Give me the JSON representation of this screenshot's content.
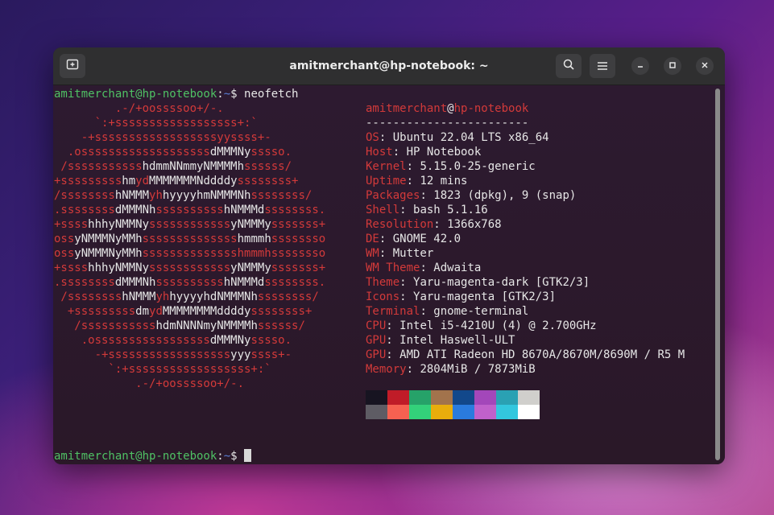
{
  "window": {
    "title": "amitmerchant@hp-notebook: ~"
  },
  "toolbar": {
    "new_tab_icon": "new-tab-icon",
    "search_icon": "search-icon",
    "menu_icon": "hamburger-menu-icon",
    "minimize_icon": "minimize-icon",
    "maximize_icon": "maximize-icon",
    "close_icon": "close-icon"
  },
  "prompt": {
    "user_host": "amitmerchant@hp-notebook",
    "sep": ":",
    "path": "~",
    "dollar": "$ ",
    "command": "neofetch"
  },
  "logo": [
    [
      [
        "r",
        "         .-/+oossssoo+/-."
      ]
    ],
    [
      [
        "r",
        "      `:+ssssssssssssssssss+:`"
      ]
    ],
    [
      [
        "r",
        "    -+ssssssssssssssssssyyssss+-"
      ]
    ],
    [
      [
        "r",
        "  .osssssssssssssssssss"
      ],
      [
        "w",
        "dMMMNy"
      ],
      [
        "r",
        "sssso."
      ]
    ],
    [
      [
        "r",
        " /sssssssssss"
      ],
      [
        "w",
        "hdmmNNmmyNMMMMh"
      ],
      [
        "r",
        "ssssss/"
      ]
    ],
    [
      [
        "r",
        "+sssssssss"
      ],
      [
        "w",
        "hm"
      ],
      [
        "r",
        "yd"
      ],
      [
        "w",
        "MMMMMMMNddddy"
      ],
      [
        "r",
        "ssssssss+"
      ]
    ],
    [
      [
        "r",
        "/ssssssss"
      ],
      [
        "w",
        "hNMMM"
      ],
      [
        "r",
        "yh"
      ],
      [
        "w",
        "hyyyyhmNMMMNh"
      ],
      [
        "r",
        "ssssssss/"
      ]
    ],
    [
      [
        "r",
        ".ssssssss"
      ],
      [
        "w",
        "dMMMNh"
      ],
      [
        "r",
        "ssssssssss"
      ],
      [
        "w",
        "hNMMMd"
      ],
      [
        "r",
        "ssssssss."
      ]
    ],
    [
      [
        "r",
        "+ssss"
      ],
      [
        "w",
        "hhhyNMMNy"
      ],
      [
        "r",
        "ssssssssssss"
      ],
      [
        "w",
        "yNMMMy"
      ],
      [
        "r",
        "sssssss+"
      ]
    ],
    [
      [
        "r",
        "oss"
      ],
      [
        "w",
        "yNMMMNyMMh"
      ],
      [
        "r",
        "ssssssssssssss"
      ],
      [
        "w",
        "hmmmh"
      ],
      [
        "r",
        "ssssssso"
      ]
    ],
    [
      [
        "r",
        "oss"
      ],
      [
        "w",
        "yNMMMNyMMh"
      ],
      [
        "r",
        "sssssssssssssshmmmhssssssso"
      ]
    ],
    [
      [
        "r",
        "+ssss"
      ],
      [
        "w",
        "hhhyNMMNy"
      ],
      [
        "r",
        "ssssssssssss"
      ],
      [
        "w",
        "yNMMMy"
      ],
      [
        "r",
        "sssssss+"
      ]
    ],
    [
      [
        "r",
        ".ssssssss"
      ],
      [
        "w",
        "dMMMNh"
      ],
      [
        "r",
        "ssssssssss"
      ],
      [
        "w",
        "hNMMMd"
      ],
      [
        "r",
        "ssssssss."
      ]
    ],
    [
      [
        "r",
        " /ssssssss"
      ],
      [
        "w",
        "hNMMM"
      ],
      [
        "r",
        "yh"
      ],
      [
        "w",
        "hyyyyhdNMMMNh"
      ],
      [
        "r",
        "ssssssss/"
      ]
    ],
    [
      [
        "r",
        "  +sssssssss"
      ],
      [
        "w",
        "dm"
      ],
      [
        "r",
        "yd"
      ],
      [
        "w",
        "MMMMMMMMddddy"
      ],
      [
        "r",
        "ssssssss+"
      ]
    ],
    [
      [
        "r",
        "   /sssssssssss"
      ],
      [
        "w",
        "hdmNNNNmyNMMMMh"
      ],
      [
        "r",
        "ssssss/"
      ]
    ],
    [
      [
        "r",
        "    .osssssssssssssssss"
      ],
      [
        "w",
        "dMMMNy"
      ],
      [
        "r",
        "sssso."
      ]
    ],
    [
      [
        "r",
        "      -+ssssssssssssssssss"
      ],
      [
        "w",
        "yyy"
      ],
      [
        "r",
        "ssss+-"
      ]
    ],
    [
      [
        "r",
        "        `:+ssssssssssssssssss+:`"
      ]
    ],
    [
      [
        "r",
        "            .-/+oossssoo+/-."
      ]
    ]
  ],
  "info": {
    "user": "amitmerchant",
    "at": "@",
    "host": "hp-notebook",
    "divider": "------------------------",
    "entries": [
      {
        "label": "OS",
        "value": "Ubuntu 22.04 LTS x86_64"
      },
      {
        "label": "Host",
        "value": "HP Notebook"
      },
      {
        "label": "Kernel",
        "value": "5.15.0-25-generic"
      },
      {
        "label": "Uptime",
        "value": "12 mins"
      },
      {
        "label": "Packages",
        "value": "1823 (dpkg), 9 (snap)"
      },
      {
        "label": "Shell",
        "value": "bash 5.1.16"
      },
      {
        "label": "Resolution",
        "value": "1366x768"
      },
      {
        "label": "DE",
        "value": "GNOME 42.0"
      },
      {
        "label": "WM",
        "value": "Mutter"
      },
      {
        "label": "WM Theme",
        "value": "Adwaita"
      },
      {
        "label": "Theme",
        "value": "Yaru-magenta-dark [GTK2/3]"
      },
      {
        "label": "Icons",
        "value": "Yaru-magenta [GTK2/3]"
      },
      {
        "label": "Terminal",
        "value": "gnome-terminal"
      },
      {
        "label": "CPU",
        "value": "Intel i5-4210U (4) @ 2.700GHz"
      },
      {
        "label": "GPU",
        "value": "Intel Haswell-ULT"
      },
      {
        "label": "GPU",
        "value": "AMD ATI Radeon HD 8670A/8670M/8690M / R5 M"
      },
      {
        "label": "Memory",
        "value": "2804MiB / 7873MiB"
      }
    ],
    "palette_dark": [
      "#171421",
      "#c01c28",
      "#26a269",
      "#a2734c",
      "#12488b",
      "#a347ba",
      "#2aa1b3",
      "#d0cfcc"
    ],
    "palette_bright": [
      "#5e5c64",
      "#f66151",
      "#33d17a",
      "#e9ad0c",
      "#2a7bde",
      "#c061cb",
      "#33c7de",
      "#ffffff"
    ]
  }
}
